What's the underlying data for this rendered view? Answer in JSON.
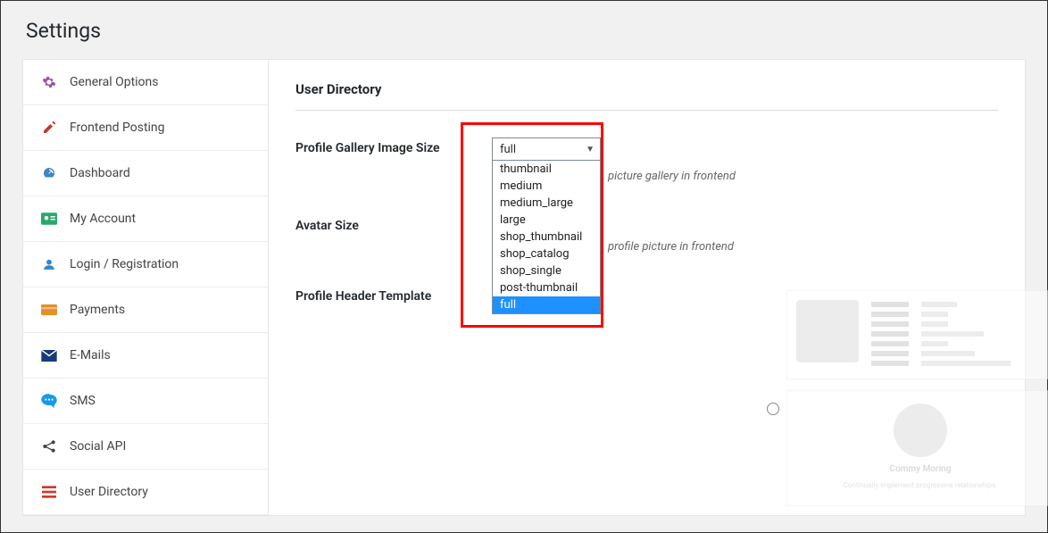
{
  "page_title": "Settings",
  "sidebar": {
    "items": [
      {
        "label": "General Options",
        "icon": "gear",
        "color": "#a0519f"
      },
      {
        "label": "Frontend Posting",
        "icon": "pencil",
        "color": "#c0392b"
      },
      {
        "label": "Dashboard",
        "icon": "gauge",
        "color": "#3f84c4"
      },
      {
        "label": "My Account",
        "icon": "id-card",
        "color": "#2aa86b"
      },
      {
        "label": "Login / Registration",
        "icon": "user",
        "color": "#2f86d0"
      },
      {
        "label": "Payments",
        "icon": "credit-card",
        "color": "#e2902a"
      },
      {
        "label": "E-Mails",
        "icon": "envelope",
        "color": "#173a79"
      },
      {
        "label": "SMS",
        "icon": "comment",
        "color": "#189aea"
      },
      {
        "label": "Social API",
        "icon": "share",
        "color": "#444444"
      },
      {
        "label": "User Directory",
        "icon": "list",
        "color": "#d0392b"
      }
    ]
  },
  "section_title": "User Directory",
  "fields": {
    "gallery_size": {
      "label": "Profile Gallery Image Size",
      "selected": "full",
      "options": [
        "thumbnail",
        "medium",
        "medium_large",
        "large",
        "shop_thumbnail",
        "shop_catalog",
        "shop_single",
        "post-thumbnail",
        "full"
      ],
      "hint_partial": "picture gallery in frontend"
    },
    "avatar_size": {
      "label": "Avatar Size",
      "hint_partial": "profile picture in frontend"
    },
    "header_template": {
      "label": "Profile Header Template"
    }
  },
  "preview": {
    "name": "Commy Moring",
    "subtitle": "Continually implement progressive relationships."
  }
}
